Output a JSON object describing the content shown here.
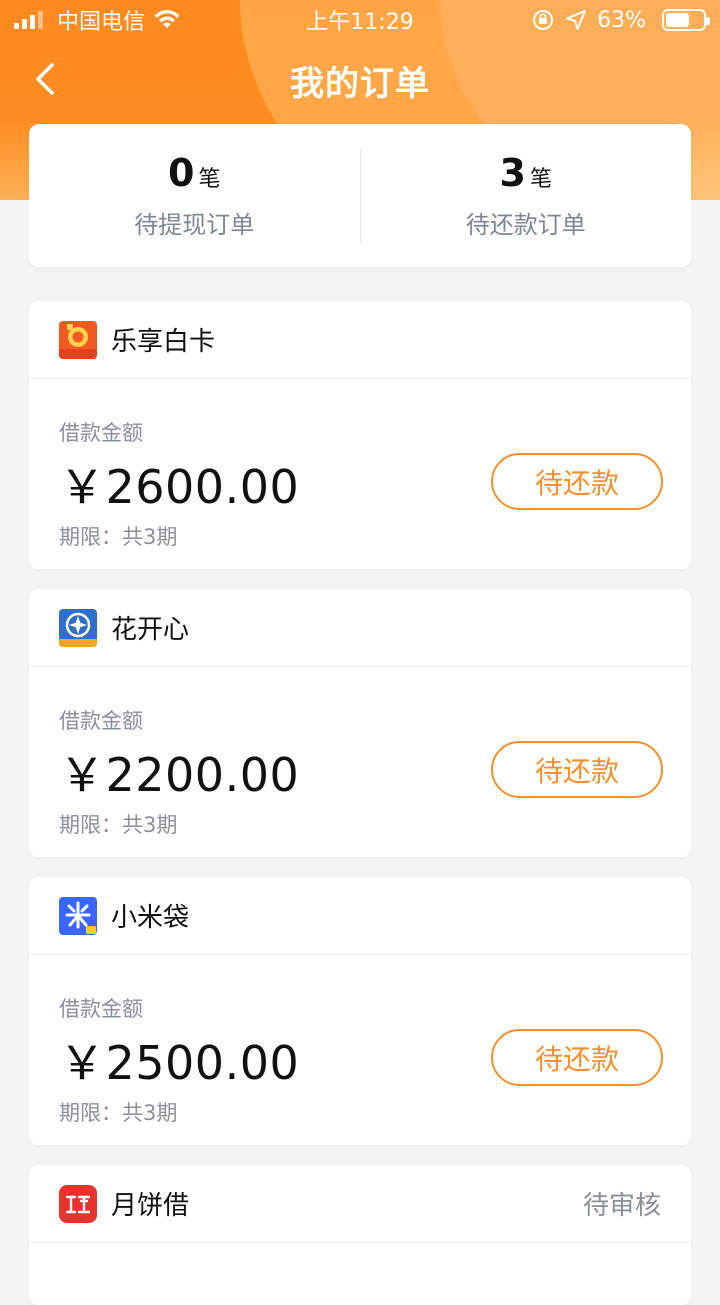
{
  "status_bar": {
    "carrier": "中国电信",
    "time": "上午11:29",
    "battery": "63%",
    "battery_level": 0.63
  },
  "nav": {
    "title": "我的订单",
    "back_icon": "chevron-left-icon"
  },
  "summary": {
    "pending_withdraw": {
      "count": "0",
      "unit": "笔",
      "label": "待提现订单"
    },
    "pending_repay": {
      "count": "3",
      "unit": "笔",
      "label": "待还款订单"
    }
  },
  "orders": [
    {
      "name": "乐享白卡",
      "logo_icon": "lexiang-logo-icon",
      "logo_color": "#f15a22",
      "amount_label": "借款金额",
      "amount": "￥2600.00",
      "period": "期限：共3期",
      "action": "待还款"
    },
    {
      "name": "花开心",
      "logo_icon": "huakaixin-logo-icon",
      "logo_color": "#2f6fc8",
      "amount_label": "借款金额",
      "amount": "￥2200.00",
      "period": "期限：共3期",
      "action": "待还款"
    },
    {
      "name": "小米袋",
      "logo_icon": "xiaomidai-logo-icon",
      "logo_color": "#3a66ff",
      "amount_label": "借款金额",
      "amount": "￥2500.00",
      "period": "期限：共3期",
      "action": "待还款"
    },
    {
      "name": "月饼借",
      "logo_icon": "yuebingjie-logo-icon",
      "logo_color": "#e8322d",
      "status": "待审核"
    }
  ],
  "colors": {
    "accent": "#f4912b",
    "header_gradient_top": "#ff8a1f",
    "header_gradient_bottom": "#ffb155",
    "background": "#f4f4f6"
  }
}
